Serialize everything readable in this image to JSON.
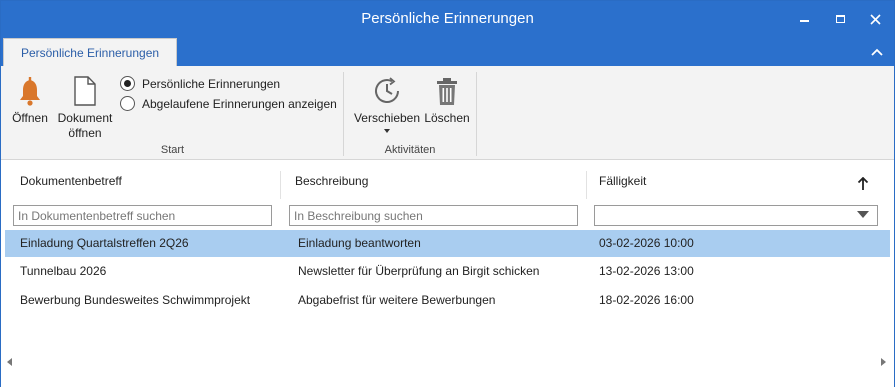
{
  "window": {
    "title": "Persönliche Erinnerungen",
    "colors": {
      "titlebar": "#2b70cc",
      "selection": "#a9cdf0",
      "accent_icon": "#d9772b"
    }
  },
  "tabs": [
    {
      "label": "Persönliche Erinnerungen",
      "active": true
    }
  ],
  "ribbon": {
    "start_group": {
      "label": "Start",
      "open_button": {
        "label": "Öffnen",
        "icon": "bell-icon"
      },
      "open_document_button": {
        "label_line1": "Dokument",
        "label_line2": "öffnen",
        "icon": "document-icon"
      },
      "radio_personal": {
        "label": "Persönliche Erinnerungen",
        "checked": true
      },
      "radio_expired": {
        "label": "Abgelaufene Erinnerungen anzeigen",
        "checked": false
      }
    },
    "activities_group": {
      "label": "Aktivitäten",
      "postpone_button": {
        "label": "Verschieben",
        "icon": "clock-icon",
        "has_dropdown": true
      },
      "delete_button": {
        "label": "Löschen",
        "icon": "trash-icon"
      }
    }
  },
  "grid": {
    "columns": [
      "Dokumentenbetreff",
      "Beschreibung",
      "Fälligkeit"
    ],
    "sort": {
      "column": "Fälligkeit",
      "direction": "ascending"
    },
    "filters": {
      "subject_placeholder": "In Dokumentenbetreff suchen",
      "description_placeholder": "In Beschreibung suchen",
      "due_value": ""
    },
    "rows": [
      {
        "subject": "Einladung Quartalstreffen 2Q26",
        "description": "Einladung beantworten",
        "due": "03-02-2026 10:00",
        "selected": true
      },
      {
        "subject": "Tunnelbau 2026",
        "description": "Newsletter für Überprüfung an Birgit schicken",
        "due": "13-02-2026 13:00",
        "selected": false
      },
      {
        "subject": "Bewerbung Bundesweites Schwimmprojekt",
        "description": "Abgabefrist für weitere Bewerbungen",
        "due": "18-02-2026 16:00",
        "selected": false
      }
    ]
  }
}
